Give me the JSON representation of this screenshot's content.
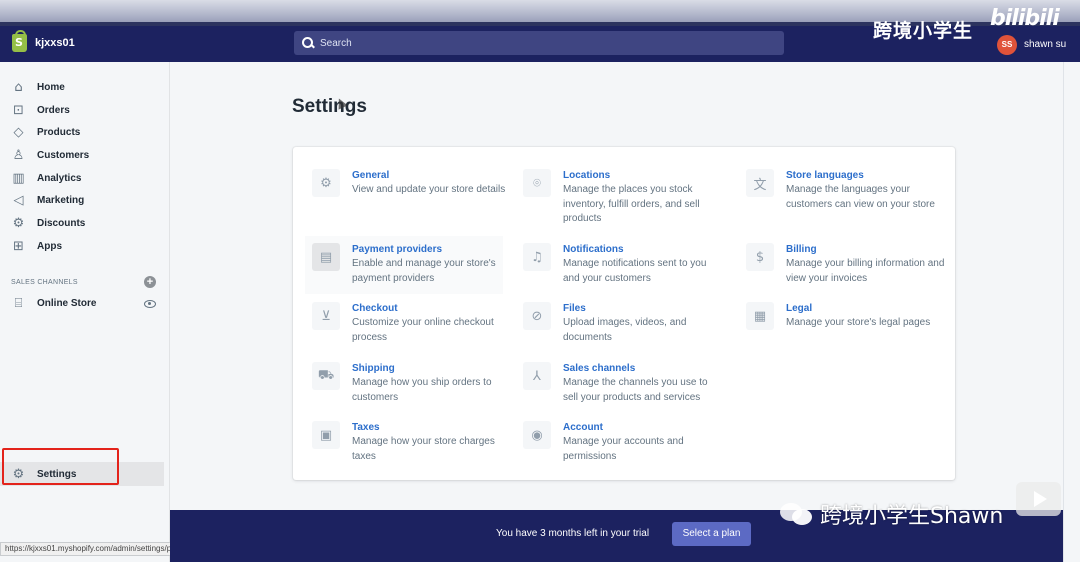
{
  "header": {
    "store_name": "kjxxs01",
    "search_placeholder": "Search",
    "watermark_cn": "跨境小学生",
    "watermark_logo": "bilibili",
    "avatar_initials": "SS",
    "user_name": "shawn su"
  },
  "sidebar": {
    "items": [
      {
        "label": "Home",
        "icon": "home-icon"
      },
      {
        "label": "Orders",
        "icon": "orders-icon"
      },
      {
        "label": "Products",
        "icon": "tag-icon"
      },
      {
        "label": "Customers",
        "icon": "person-icon"
      },
      {
        "label": "Analytics",
        "icon": "bar-chart-icon"
      },
      {
        "label": "Marketing",
        "icon": "megaphone-icon"
      },
      {
        "label": "Discounts",
        "icon": "discount-icon"
      },
      {
        "label": "Apps",
        "icon": "apps-icon"
      }
    ],
    "sales_channels_label": "SALES CHANNELS",
    "online_store_label": "Online Store",
    "settings_label": "Settings",
    "status_url": "https://kjxxs01.myshopify.com/admin/settings/payments"
  },
  "main": {
    "title": "Settings",
    "tiles": [
      {
        "title": "General",
        "desc": "View and update your store details",
        "icon": "gear-icon"
      },
      {
        "title": "Locations",
        "desc": "Manage the places you stock inventory, fulfill orders, and sell products",
        "icon": "location-pin-icon"
      },
      {
        "title": "Store languages",
        "desc": "Manage the languages your customers can view on your store",
        "icon": "translate-icon"
      },
      {
        "title": "Payment providers",
        "desc": "Enable and manage your store's payment providers",
        "icon": "payment-icon"
      },
      {
        "title": "Notifications",
        "desc": "Manage notifications sent to you and your customers",
        "icon": "bell-icon"
      },
      {
        "title": "Billing",
        "desc": "Manage your billing information and view your invoices",
        "icon": "billing-icon"
      },
      {
        "title": "Checkout",
        "desc": "Customize your online checkout process",
        "icon": "cart-icon"
      },
      {
        "title": "Files",
        "desc": "Upload images, videos, and documents",
        "icon": "paperclip-icon"
      },
      {
        "title": "Legal",
        "desc": "Manage your store's legal pages",
        "icon": "legal-icon"
      },
      {
        "title": "Shipping",
        "desc": "Manage how you ship orders to customers",
        "icon": "truck-icon"
      },
      {
        "title": "Sales channels",
        "desc": "Manage the channels you use to sell your products and services",
        "icon": "channels-icon"
      },
      {
        "title": "Taxes",
        "desc": "Manage how your store charges taxes",
        "icon": "taxes-icon"
      },
      {
        "title": "Account",
        "desc": "Manage your accounts and permissions",
        "icon": "account-icon"
      }
    ]
  },
  "trial": {
    "text": "You have 3 months left in your trial",
    "button": "Select a plan"
  },
  "watermark2": "跨境小学生Shawn",
  "colors": {
    "header_bg": "#1c2260",
    "link": "#2c6ecb",
    "button": "#5c6ac4",
    "highlight_box": "#e3231b"
  }
}
